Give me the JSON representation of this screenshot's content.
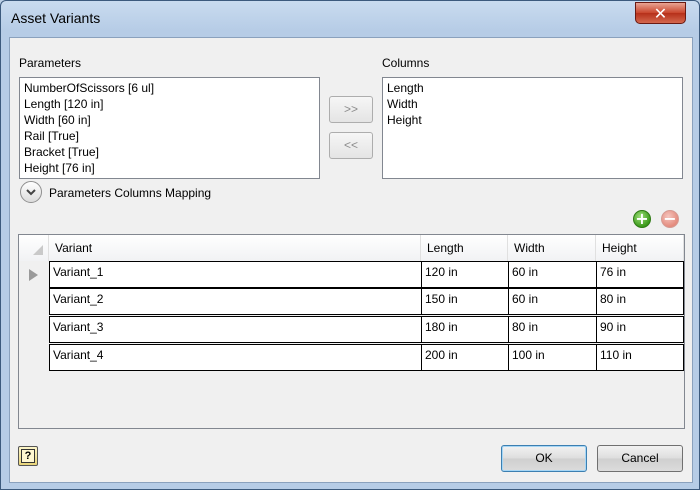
{
  "window": {
    "title": "Asset Variants",
    "close_label": "✕"
  },
  "parameters": {
    "label": "Parameters",
    "items": [
      "NumberOfScissors [6 ul]",
      "Length [120 in]",
      "Width [60 in]",
      "Rail [True]",
      "Bracket [True]",
      "Height [76 in]"
    ]
  },
  "columns": {
    "label": "Columns",
    "items": [
      "Length",
      "Width",
      "Height"
    ]
  },
  "move": {
    "add_label": ">>",
    "remove_label": "<<"
  },
  "mapping": {
    "label": "Parameters Columns Mapping"
  },
  "grid": {
    "headers": [
      "Variant",
      "Length",
      "Width",
      "Height"
    ],
    "rows": [
      [
        "Variant_1",
        "120 in",
        "60 in",
        "76 in"
      ],
      [
        "Variant_2",
        "150 in",
        "60 in",
        "80 in"
      ],
      [
        "Variant_3",
        "180 in",
        "80 in",
        "90 in"
      ],
      [
        "Variant_4",
        "200 in",
        "100 in",
        "110 in"
      ]
    ],
    "selected_row": 0
  },
  "icons": {
    "add": "plus-icon",
    "remove": "minus-icon",
    "help": "help-icon"
  },
  "help_glyph": "?",
  "footer": {
    "ok_label": "OK",
    "cancel_label": "Cancel"
  }
}
